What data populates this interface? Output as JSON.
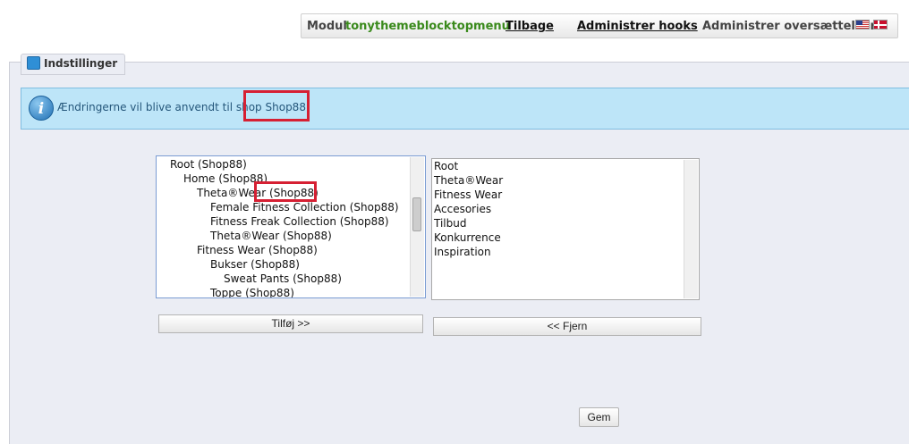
{
  "topbar": {
    "module_label": "Modul",
    "module_name": "tonythemeblocktopmenu",
    "back_link": "Tilbage",
    "hooks_link": "Administrer hooks",
    "translations_label": "Administrer oversættelser",
    "flags": [
      "us-flag-icon",
      "dk-flag-icon"
    ]
  },
  "panel": {
    "legend_icon": "settings-icon",
    "legend": "Indstillinger"
  },
  "info": {
    "icon": "info-icon",
    "text_prefix": "Ændringerne vil blive anvendt til shop",
    "shop_name": "Shop88",
    "text_suffix": "."
  },
  "available_items": [
    {
      "label": "Root (Shop88)"
    },
    {
      "label": "Home (Shop88)"
    },
    {
      "label": "Theta®Wear (Shop88)"
    },
    {
      "label": "Female Fitness Collection (Shop88)"
    },
    {
      "label": "Fitness Freak Collection (Shop88)"
    },
    {
      "label": "Theta®Wear (Shop88)"
    },
    {
      "label": "Fitness Wear (Shop88)"
    },
    {
      "label": "Bukser (Shop88)"
    },
    {
      "label": "Sweat Pants (Shop88)"
    },
    {
      "label": "Toppe (Shop88)"
    }
  ],
  "selected_items": [
    "Root",
    "Theta®Wear",
    "Fitness Wear",
    "Accesories",
    "Tilbud",
    "Konkurrence",
    "Inspiration"
  ],
  "buttons": {
    "add": "Tilføj >>",
    "remove": "<< Fjern",
    "save": "Gem"
  },
  "colors": {
    "info_bg": "#bde5f8",
    "info_text": "#25577b",
    "module_name": "#3a8a1c",
    "highlight": "#d62033",
    "panel_bg": "#ebedf4"
  }
}
